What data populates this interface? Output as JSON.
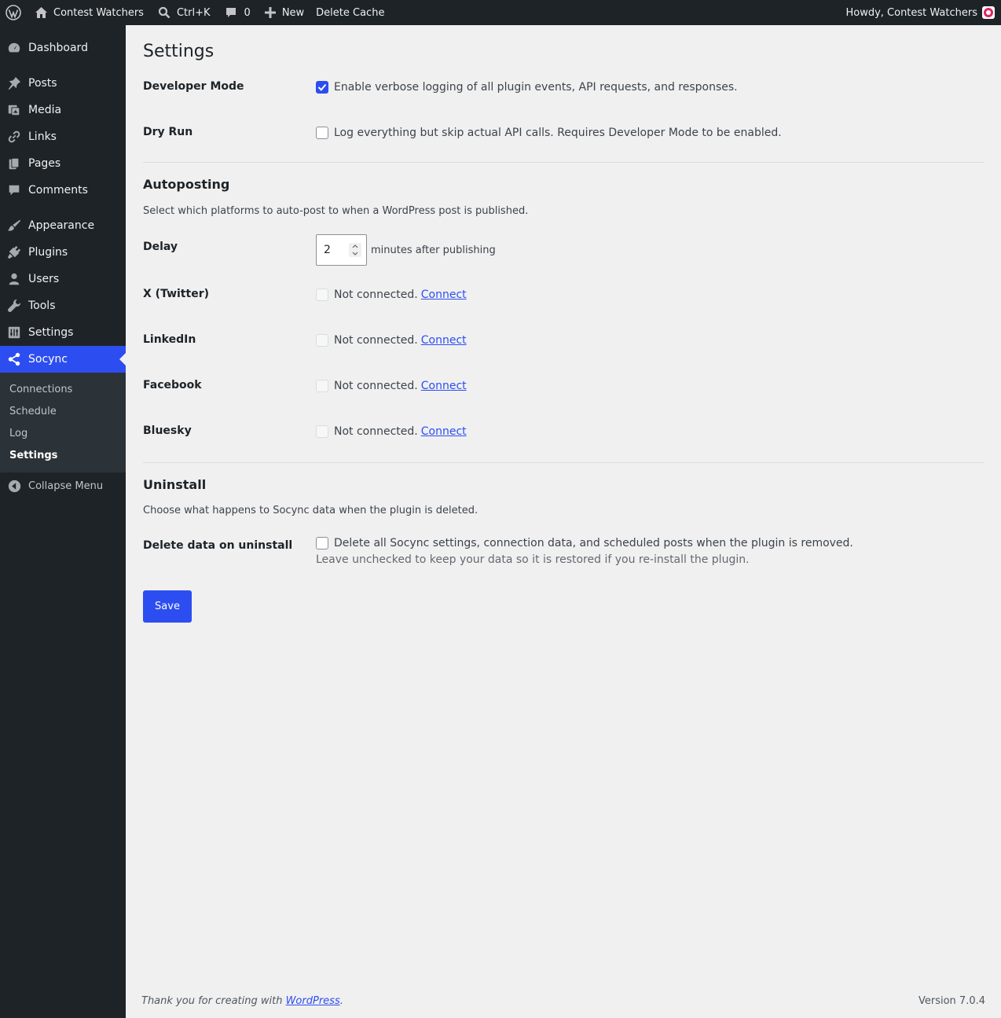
{
  "adminbar": {
    "site_name": "Contest Watchers",
    "search_shortcut": "Ctrl+K",
    "comments_count": "0",
    "new_label": "New",
    "delete_cache_label": "Delete Cache",
    "howdy": "Howdy, Contest Watchers"
  },
  "sidebar": {
    "items": [
      {
        "label": "Dashboard"
      },
      {
        "label": "Posts"
      },
      {
        "label": "Media"
      },
      {
        "label": "Links"
      },
      {
        "label": "Pages"
      },
      {
        "label": "Comments"
      },
      {
        "label": "Appearance"
      },
      {
        "label": "Plugins"
      },
      {
        "label": "Users"
      },
      {
        "label": "Tools"
      },
      {
        "label": "Settings"
      },
      {
        "label": "Socync"
      }
    ],
    "submenu": [
      "Connections",
      "Schedule",
      "Log",
      "Settings"
    ],
    "collapse_label": "Collapse Menu"
  },
  "page": {
    "title": "Settings",
    "developer_mode": {
      "label": "Developer Mode",
      "text": "Enable verbose logging of all plugin events, API requests, and responses.",
      "checked": true
    },
    "dry_run": {
      "label": "Dry Run",
      "text": "Log everything but skip actual API calls. Requires Developer Mode to be enabled.",
      "checked": false
    },
    "autoposting": {
      "heading": "Autoposting",
      "description": "Select which platforms to auto-post to when a WordPress post is published.",
      "delay_label": "Delay",
      "delay_value": "2",
      "delay_suffix": "minutes after publishing",
      "platforms": [
        {
          "label": "X (Twitter)",
          "status": "Not connected.",
          "link": "Connect"
        },
        {
          "label": "LinkedIn",
          "status": "Not connected.",
          "link": "Connect"
        },
        {
          "label": "Facebook",
          "status": "Not connected.",
          "link": "Connect"
        },
        {
          "label": "Bluesky",
          "status": "Not connected.",
          "link": "Connect"
        }
      ]
    },
    "uninstall": {
      "heading": "Uninstall",
      "description": "Choose what happens to Socync data when the plugin is deleted.",
      "label": "Delete data on uninstall",
      "text": "Delete all Socync settings, connection data, and scheduled posts when the plugin is removed.",
      "hint": "Leave unchecked to keep your data so it is restored if you re-install the plugin."
    },
    "save_label": "Save"
  },
  "footer": {
    "thanks_prefix": "Thank you for creating with ",
    "thanks_link": "WordPress",
    "thanks_suffix": ".",
    "version": "Version 7.0.4"
  },
  "colors": {
    "accent": "#2c4ef0",
    "adminbar_bg": "#1d2327",
    "content_bg": "#f0f0f1"
  }
}
